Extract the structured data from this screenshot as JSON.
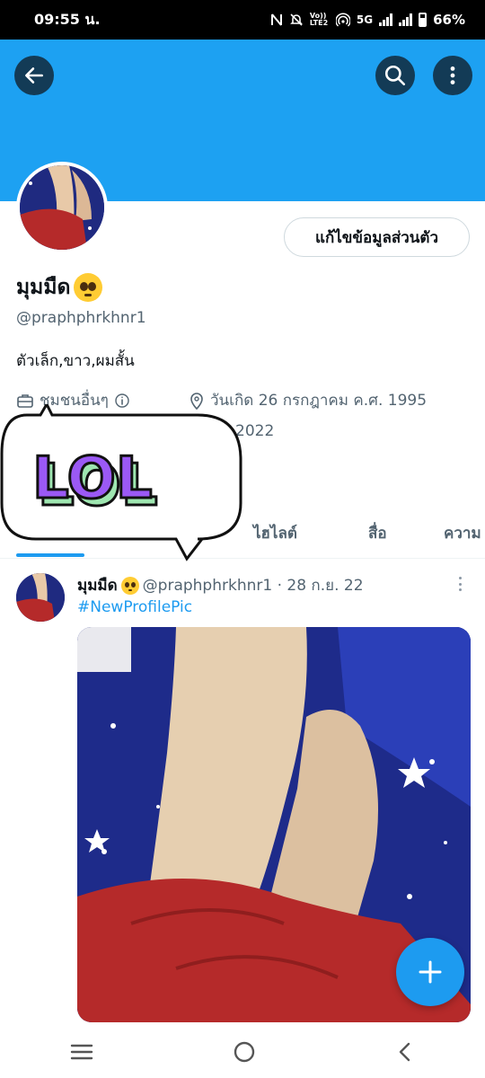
{
  "status_bar": {
    "time": "09:55 น.",
    "network_label": "5G",
    "volte_label": "Vo)) LTE2",
    "battery": "66%"
  },
  "header": {
    "back_icon": "arrow-left-icon",
    "search_icon": "search-icon",
    "more_icon": "more-vertical-icon",
    "banner_color": "#1da1f2"
  },
  "profile": {
    "edit_button": "แก้ไขข้อมูลส่วนตัว",
    "display_name": "มุมมืด",
    "handle": "@praphphrkhnr1",
    "bio": "ตัวเล็ก,ขาว,ผมสั้น",
    "category": "ชุมชนอื่นๆ",
    "birthday": "วันเกิด 26 กรกฎาคม ค.ศ. 1995",
    "joined_fragment": "2022"
  },
  "sticker": {
    "text": "LOL"
  },
  "tabs": [
    {
      "label": "ไฮไลต์"
    },
    {
      "label": "สื่อ"
    },
    {
      "label": "ความ"
    }
  ],
  "tweet": {
    "author": "มุมมืด",
    "handle_date": "@praphphrkhnr1 · 28 ก.ย. 22",
    "hashtag": "#NewProfilePic"
  },
  "fab": {
    "icon": "plus-icon"
  },
  "nav": {
    "recents_icon": "recents-icon",
    "home_icon": "home-circle-icon",
    "back_icon": "back-chevron-icon"
  },
  "colors": {
    "accent": "#1d9bf0",
    "secondary_text": "#536471"
  }
}
